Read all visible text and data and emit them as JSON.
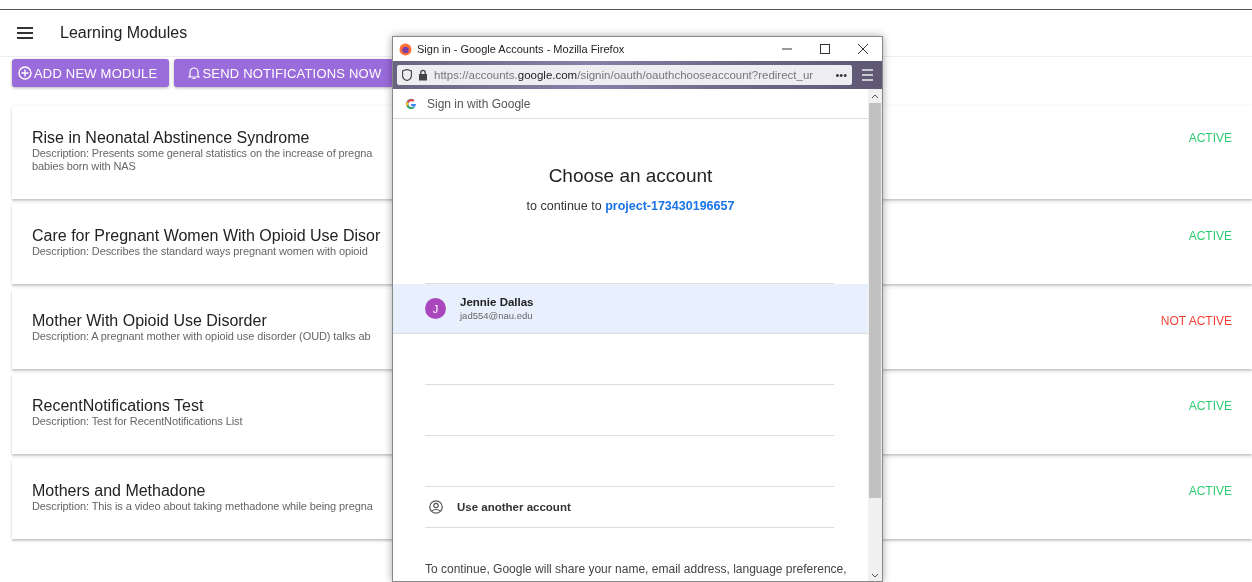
{
  "app_bar": {
    "title": "Learning Modules"
  },
  "actions": [
    {
      "label": "ADD NEW MODULE",
      "kind": "add"
    },
    {
      "label": "SEND NOTIFICATIONS NOW",
      "kind": "notify"
    }
  ],
  "modules": [
    {
      "title": "Rise in Neonatal Abstinence Syndrome",
      "description": "Description: Presents some general statistics on the increase of pregna\nbabies born with NAS",
      "status": "ACTIVE",
      "active": true
    },
    {
      "title": "Care for Pregnant Women With Opioid Use Disor",
      "description": "Description: Describes the standard ways pregnant women with opioid",
      "status": "ACTIVE",
      "active": true
    },
    {
      "title": "Mother With Opioid Use Disorder",
      "description": "Description: A pregnant mother with opioid use disorder (OUD) talks ab",
      "status": "NOT ACTIVE",
      "active": false
    },
    {
      "title": "RecentNotifications Test",
      "description": "Description: Test for RecentNotifications List",
      "status": "ACTIVE",
      "active": true
    },
    {
      "title": "Mothers and Methadone",
      "description": "Description: This is a video about taking methadone while being pregna",
      "status": "ACTIVE",
      "active": true
    }
  ],
  "popup": {
    "window_title": "Sign in - Google Accounts - Mozilla Firefox",
    "url": {
      "prefix": "https://accounts.",
      "domain": "google.com",
      "rest": "/signin/oauth/oauthchooseaccount?redirect_ur"
    },
    "url_more": "•••",
    "header": "Sign in with Google",
    "heading": "Choose an account",
    "subheading": "to continue to",
    "project": "project-173430196657",
    "accounts": [
      {
        "initial": "J",
        "name": "Jennie Dallas",
        "email": "jad554@nau.edu",
        "selected": true
      }
    ],
    "other_account": "Use another account",
    "footer": "To continue, Google will share your name, email address, language preference,"
  }
}
